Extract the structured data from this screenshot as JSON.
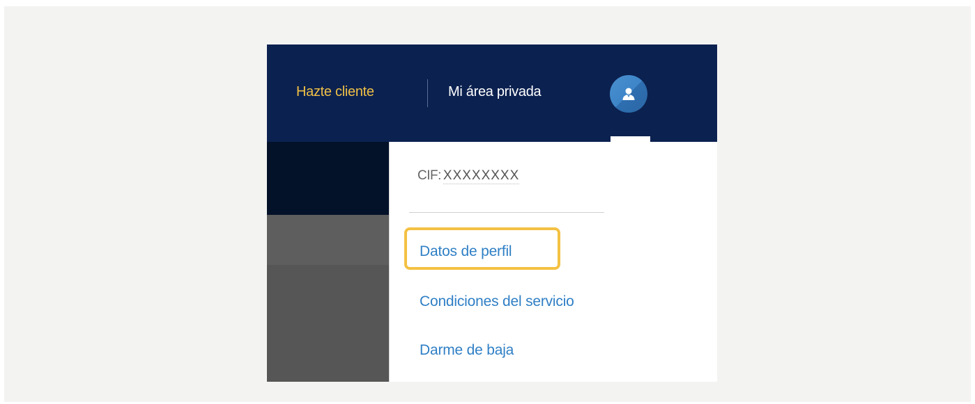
{
  "header": {
    "hazte_cliente": "Hazte cliente",
    "mi_area_privada": "Mi área privada",
    "avatar_icon": "user-avatar-icon"
  },
  "dropdown": {
    "cif_label": "CIF:",
    "cif_value": "XXXXXXXX",
    "items": [
      {
        "label": "Datos de perfil",
        "highlighted": true
      },
      {
        "label": "Condiciones del servicio"
      },
      {
        "label": "Darme de baja"
      }
    ]
  },
  "colors": {
    "header_bg": "#0b2150",
    "hazte_cliente": "#f0c046",
    "link": "#2f7fc5",
    "highlight": "#f4c143",
    "avatar": "#3d85c8"
  }
}
